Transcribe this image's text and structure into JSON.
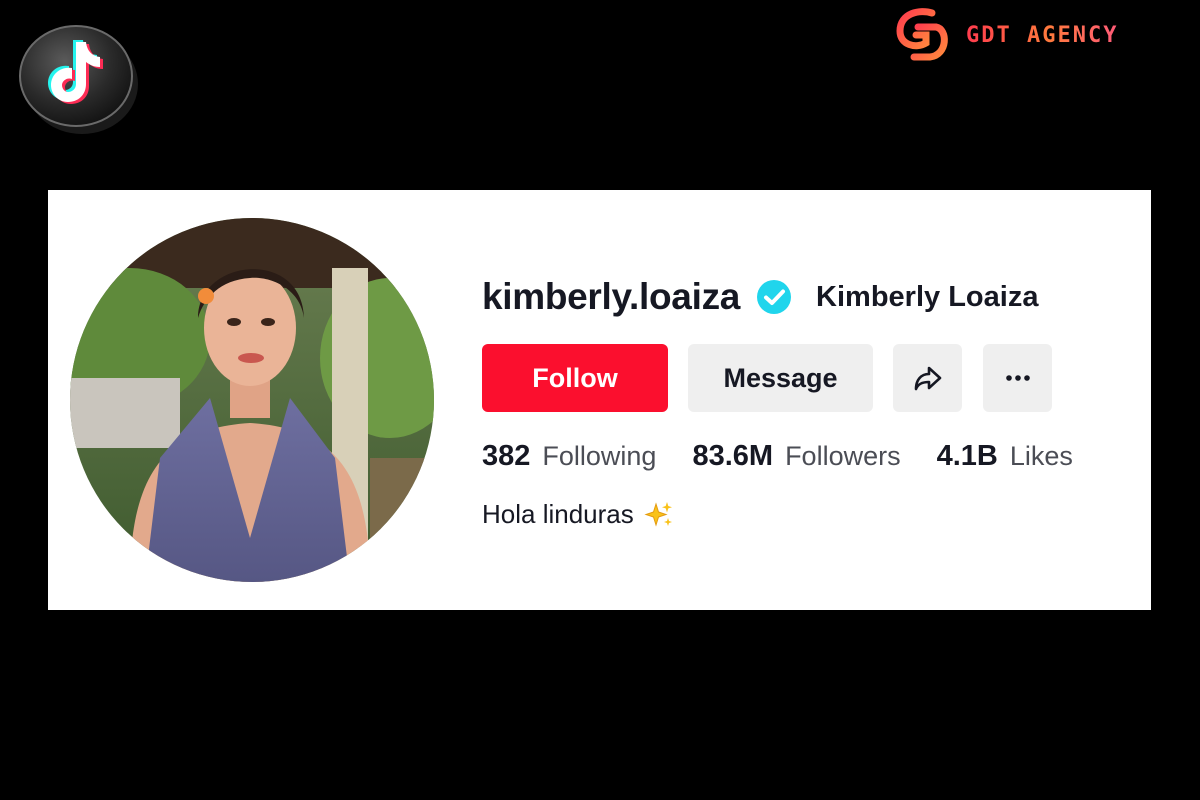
{
  "logo": {
    "icon": "tiktok-3d-logo-icon"
  },
  "brand": {
    "mark_icon": "gdt-monogram-icon",
    "name": "GDT AGENCY",
    "colors": {
      "from": "#ff3c4e",
      "to": "#ff7a3d"
    }
  },
  "profile": {
    "username": "kimberly.loaiza",
    "verified_icon": "verified-badge-icon",
    "display_name": "Kimberly Loaiza",
    "avatar_icon": "profile-avatar-photo",
    "buttons": {
      "follow": "Follow",
      "message": "Message",
      "share_icon": "share-arrow-icon",
      "more_icon": "more-dots-icon"
    },
    "stats": [
      {
        "value": "382",
        "label": "Following"
      },
      {
        "value": "83.6M",
        "label": "Followers"
      },
      {
        "value": "4.1B",
        "label": "Likes"
      }
    ],
    "bio": "Hola linduras",
    "bio_emoji_icon": "sparkles-icon"
  },
  "colors": {
    "background": "#000000",
    "card": "#ffffff",
    "follow": "#fb0f2e",
    "verified": "#20d5ec",
    "text": "#161823"
  }
}
